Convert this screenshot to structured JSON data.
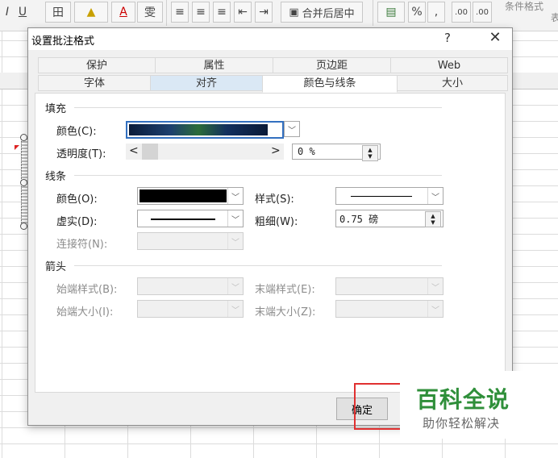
{
  "ribbon": {
    "items": [
      "I",
      "U",
      "田",
      "A",
      "雯",
      "合并后居中",
      "%",
      ".00",
      ".00"
    ],
    "conditional_format": "条件格式",
    "table_format_partial": "表"
  },
  "dialog": {
    "title": "设置批注格式",
    "help": "?",
    "close": "✕",
    "tabs_row1": [
      "保护",
      "属性",
      "页边距",
      "Web"
    ],
    "tabs_row2": [
      "字体",
      "对齐",
      "颜色与线条",
      "大小"
    ],
    "selected_tab": "颜色与线条",
    "fill": {
      "section": "填充",
      "color_label": "颜色(C):",
      "transparency_label": "透明度(T):",
      "transparency_value": "0 %",
      "left_arrow": "<",
      "right_arrow": ">"
    },
    "line": {
      "section": "线条",
      "color_label": "颜色(O):",
      "dash_label": "虚实(D):",
      "connector_label": "连接符(N):",
      "style_label": "样式(S):",
      "weight_label": "粗细(W):",
      "weight_value": "0.75 磅"
    },
    "arrows": {
      "section": "箭头",
      "begin_style": "始端样式(B):",
      "begin_size": "始端大小(I):",
      "end_style": "末端样式(E):",
      "end_size": "末端大小(Z):"
    },
    "ok_label": "确定"
  },
  "watermark": {
    "title": "百科全说",
    "subtitle": "助你轻松解决"
  },
  "colors": {
    "highlight_border": "#e03030",
    "watermark_green": "#2f8f3a"
  }
}
